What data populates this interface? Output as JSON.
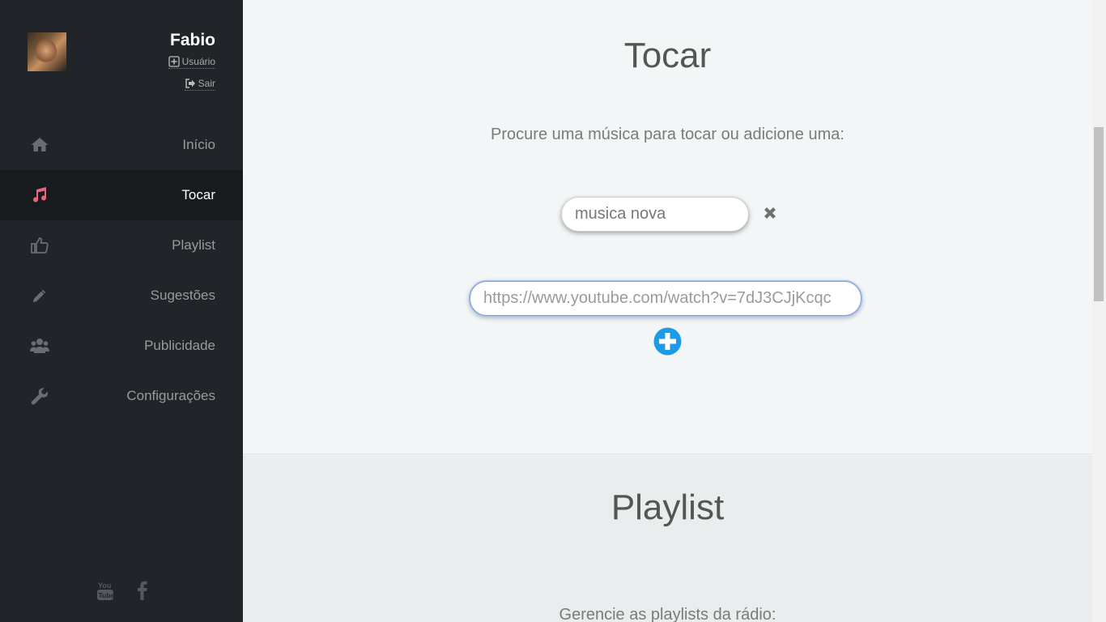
{
  "user": {
    "name": "Fabio",
    "usuario_label": "Usuário",
    "sair_label": "Sair"
  },
  "nav": {
    "items": [
      {
        "label": "Início",
        "icon": "home-icon"
      },
      {
        "label": "Tocar",
        "icon": "music-icon",
        "active": true
      },
      {
        "label": "Playlist",
        "icon": "thumbs-up-icon"
      },
      {
        "label": "Sugestões",
        "icon": "pencil-icon"
      },
      {
        "label": "Publicidade",
        "icon": "users-icon"
      },
      {
        "label": "Configurações",
        "icon": "wrench-icon"
      }
    ]
  },
  "social": [
    "youtube-icon",
    "facebook-icon"
  ],
  "play": {
    "title": "Tocar",
    "subtitle": "Procure uma música para tocar ou adicione uma:",
    "search_value": "musica nova",
    "url_placeholder": "https://www.youtube.com/watch?v=7dJ3CJjKcqc"
  },
  "playlist": {
    "title": "Playlist",
    "subtitle": "Gerencie as playlists da rádio:"
  },
  "colors": {
    "sidebar_bg": "#212529",
    "active_item_bg": "#181b1e",
    "music_icon": "#e8677c",
    "add_button": "#1e9be6"
  }
}
